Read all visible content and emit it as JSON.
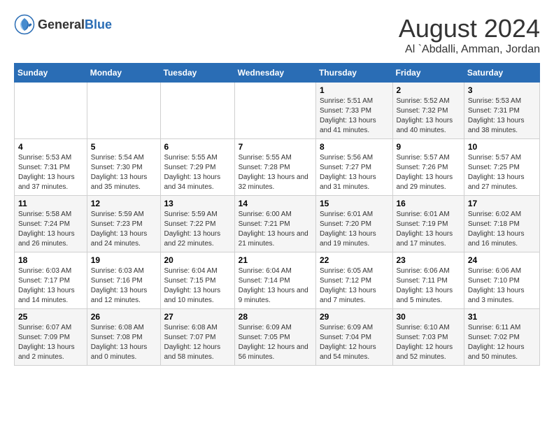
{
  "header": {
    "logo_general": "General",
    "logo_blue": "Blue",
    "month_year": "August 2024",
    "location": "Al `Abdalli, Amman, Jordan"
  },
  "weekdays": [
    "Sunday",
    "Monday",
    "Tuesday",
    "Wednesday",
    "Thursday",
    "Friday",
    "Saturday"
  ],
  "weeks": [
    [
      {
        "day": "",
        "sunrise": "",
        "sunset": "",
        "daylight": ""
      },
      {
        "day": "",
        "sunrise": "",
        "sunset": "",
        "daylight": ""
      },
      {
        "day": "",
        "sunrise": "",
        "sunset": "",
        "daylight": ""
      },
      {
        "day": "",
        "sunrise": "",
        "sunset": "",
        "daylight": ""
      },
      {
        "day": "1",
        "sunrise": "Sunrise: 5:51 AM",
        "sunset": "Sunset: 7:33 PM",
        "daylight": "Daylight: 13 hours and 41 minutes."
      },
      {
        "day": "2",
        "sunrise": "Sunrise: 5:52 AM",
        "sunset": "Sunset: 7:32 PM",
        "daylight": "Daylight: 13 hours and 40 minutes."
      },
      {
        "day": "3",
        "sunrise": "Sunrise: 5:53 AM",
        "sunset": "Sunset: 7:31 PM",
        "daylight": "Daylight: 13 hours and 38 minutes."
      }
    ],
    [
      {
        "day": "4",
        "sunrise": "Sunrise: 5:53 AM",
        "sunset": "Sunset: 7:31 PM",
        "daylight": "Daylight: 13 hours and 37 minutes."
      },
      {
        "day": "5",
        "sunrise": "Sunrise: 5:54 AM",
        "sunset": "Sunset: 7:30 PM",
        "daylight": "Daylight: 13 hours and 35 minutes."
      },
      {
        "day": "6",
        "sunrise": "Sunrise: 5:55 AM",
        "sunset": "Sunset: 7:29 PM",
        "daylight": "Daylight: 13 hours and 34 minutes."
      },
      {
        "day": "7",
        "sunrise": "Sunrise: 5:55 AM",
        "sunset": "Sunset: 7:28 PM",
        "daylight": "Daylight: 13 hours and 32 minutes."
      },
      {
        "day": "8",
        "sunrise": "Sunrise: 5:56 AM",
        "sunset": "Sunset: 7:27 PM",
        "daylight": "Daylight: 13 hours and 31 minutes."
      },
      {
        "day": "9",
        "sunrise": "Sunrise: 5:57 AM",
        "sunset": "Sunset: 7:26 PM",
        "daylight": "Daylight: 13 hours and 29 minutes."
      },
      {
        "day": "10",
        "sunrise": "Sunrise: 5:57 AM",
        "sunset": "Sunset: 7:25 PM",
        "daylight": "Daylight: 13 hours and 27 minutes."
      }
    ],
    [
      {
        "day": "11",
        "sunrise": "Sunrise: 5:58 AM",
        "sunset": "Sunset: 7:24 PM",
        "daylight": "Daylight: 13 hours and 26 minutes."
      },
      {
        "day": "12",
        "sunrise": "Sunrise: 5:59 AM",
        "sunset": "Sunset: 7:23 PM",
        "daylight": "Daylight: 13 hours and 24 minutes."
      },
      {
        "day": "13",
        "sunrise": "Sunrise: 5:59 AM",
        "sunset": "Sunset: 7:22 PM",
        "daylight": "Daylight: 13 hours and 22 minutes."
      },
      {
        "day": "14",
        "sunrise": "Sunrise: 6:00 AM",
        "sunset": "Sunset: 7:21 PM",
        "daylight": "Daylight: 13 hours and 21 minutes."
      },
      {
        "day": "15",
        "sunrise": "Sunrise: 6:01 AM",
        "sunset": "Sunset: 7:20 PM",
        "daylight": "Daylight: 13 hours and 19 minutes."
      },
      {
        "day": "16",
        "sunrise": "Sunrise: 6:01 AM",
        "sunset": "Sunset: 7:19 PM",
        "daylight": "Daylight: 13 hours and 17 minutes."
      },
      {
        "day": "17",
        "sunrise": "Sunrise: 6:02 AM",
        "sunset": "Sunset: 7:18 PM",
        "daylight": "Daylight: 13 hours and 16 minutes."
      }
    ],
    [
      {
        "day": "18",
        "sunrise": "Sunrise: 6:03 AM",
        "sunset": "Sunset: 7:17 PM",
        "daylight": "Daylight: 13 hours and 14 minutes."
      },
      {
        "day": "19",
        "sunrise": "Sunrise: 6:03 AM",
        "sunset": "Sunset: 7:16 PM",
        "daylight": "Daylight: 13 hours and 12 minutes."
      },
      {
        "day": "20",
        "sunrise": "Sunrise: 6:04 AM",
        "sunset": "Sunset: 7:15 PM",
        "daylight": "Daylight: 13 hours and 10 minutes."
      },
      {
        "day": "21",
        "sunrise": "Sunrise: 6:04 AM",
        "sunset": "Sunset: 7:14 PM",
        "daylight": "Daylight: 13 hours and 9 minutes."
      },
      {
        "day": "22",
        "sunrise": "Sunrise: 6:05 AM",
        "sunset": "Sunset: 7:12 PM",
        "daylight": "Daylight: 13 hours and 7 minutes."
      },
      {
        "day": "23",
        "sunrise": "Sunrise: 6:06 AM",
        "sunset": "Sunset: 7:11 PM",
        "daylight": "Daylight: 13 hours and 5 minutes."
      },
      {
        "day": "24",
        "sunrise": "Sunrise: 6:06 AM",
        "sunset": "Sunset: 7:10 PM",
        "daylight": "Daylight: 13 hours and 3 minutes."
      }
    ],
    [
      {
        "day": "25",
        "sunrise": "Sunrise: 6:07 AM",
        "sunset": "Sunset: 7:09 PM",
        "daylight": "Daylight: 13 hours and 2 minutes."
      },
      {
        "day": "26",
        "sunrise": "Sunrise: 6:08 AM",
        "sunset": "Sunset: 7:08 PM",
        "daylight": "Daylight: 13 hours and 0 minutes."
      },
      {
        "day": "27",
        "sunrise": "Sunrise: 6:08 AM",
        "sunset": "Sunset: 7:07 PM",
        "daylight": "Daylight: 12 hours and 58 minutes."
      },
      {
        "day": "28",
        "sunrise": "Sunrise: 6:09 AM",
        "sunset": "Sunset: 7:05 PM",
        "daylight": "Daylight: 12 hours and 56 minutes."
      },
      {
        "day": "29",
        "sunrise": "Sunrise: 6:09 AM",
        "sunset": "Sunset: 7:04 PM",
        "daylight": "Daylight: 12 hours and 54 minutes."
      },
      {
        "day": "30",
        "sunrise": "Sunrise: 6:10 AM",
        "sunset": "Sunset: 7:03 PM",
        "daylight": "Daylight: 12 hours and 52 minutes."
      },
      {
        "day": "31",
        "sunrise": "Sunrise: 6:11 AM",
        "sunset": "Sunset: 7:02 PM",
        "daylight": "Daylight: 12 hours and 50 minutes."
      }
    ]
  ]
}
